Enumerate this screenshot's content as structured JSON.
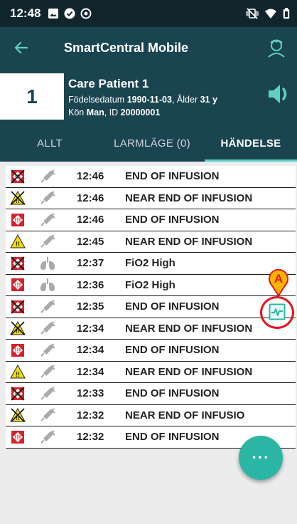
{
  "status_bar": {
    "time": "12:48"
  },
  "app_bar": {
    "title": "SmartCentral Mobile"
  },
  "patient": {
    "bed": "1",
    "name": "Care Patient 1",
    "dob_label": "Födelsedatum",
    "dob": "1990-11-03",
    "age_label": "Ålder",
    "age": "31 y",
    "sex_label": "Kön",
    "sex": "Man",
    "id_label": "ID",
    "id": "20000001"
  },
  "tabs": [
    {
      "label": "ALLT"
    },
    {
      "label": "LARMLÄGE (0)"
    },
    {
      "label": "HÄNDELSE"
    }
  ],
  "events": [
    {
      "alarm": "red-crossed",
      "device": "syringe-icon",
      "time": "12:46",
      "message": "END OF INFUSION"
    },
    {
      "alarm": "yellow-crossed",
      "device": "syringe-icon",
      "time": "12:46",
      "message": "NEAR END OF INFUSION"
    },
    {
      "alarm": "red",
      "device": "syringe-icon",
      "time": "12:46",
      "message": "END OF INFUSION"
    },
    {
      "alarm": "yellow",
      "device": "syringe-icon",
      "time": "12:45",
      "message": "NEAR END OF INFUSION"
    },
    {
      "alarm": "red-crossed",
      "device": "lungs-icon",
      "time": "12:37",
      "message": "FiO2 High"
    },
    {
      "alarm": "red",
      "device": "lungs-icon",
      "time": "12:36",
      "message": "FiO2 High"
    },
    {
      "alarm": "red-crossed",
      "device": "syringe-icon",
      "time": "12:35",
      "message": "END OF INFUSION"
    },
    {
      "alarm": "yellow-crossed",
      "device": "syringe-icon",
      "time": "12:34",
      "message": "NEAR END OF INFUSION"
    },
    {
      "alarm": "red",
      "device": "syringe-icon",
      "time": "12:34",
      "message": "END OF INFUSION"
    },
    {
      "alarm": "yellow",
      "device": "syringe-icon",
      "time": "12:34",
      "message": "NEAR END OF INFUSION"
    },
    {
      "alarm": "red-crossed",
      "device": "syringe-icon",
      "time": "12:33",
      "message": "END OF INFUSION"
    },
    {
      "alarm": "yellow-crossed",
      "device": "syringe-icon",
      "time": "12:32",
      "message": "NEAR END OF INFUSIO"
    },
    {
      "alarm": "red",
      "device": "syringe-icon",
      "time": "12:32",
      "message": "END OF INFUSION"
    }
  ],
  "callout": {
    "label": "A"
  },
  "fab": {
    "label": "···"
  },
  "colors": {
    "header_dark": "#11262c",
    "header": "#1a4550",
    "accent": "#5ed1c4",
    "fab": "#2bb5a4",
    "alarm_red": "#d8202a",
    "alarm_yellow": "#f2dc00",
    "callout": "#e4141c"
  }
}
